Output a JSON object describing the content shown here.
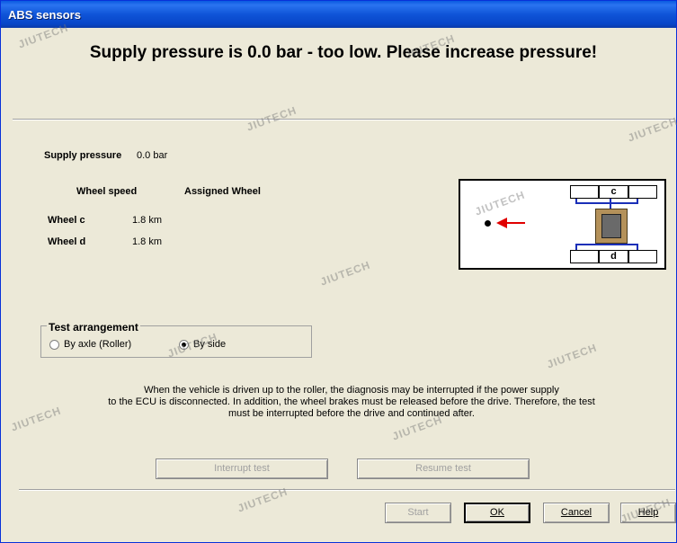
{
  "window": {
    "title": "ABS sensors"
  },
  "banner": {
    "message": "Supply pressure is  0.0 bar - too low. Please increase pressure!"
  },
  "supply": {
    "label": "Supply pressure",
    "value": "0.0 bar"
  },
  "table": {
    "headers": [
      "Wheel speed",
      "Assigned Wheel"
    ],
    "rows": [
      {
        "wheel": "Wheel c",
        "speed": "1.8 km"
      },
      {
        "wheel": "Wheel d",
        "speed": "1.8 km"
      }
    ]
  },
  "diagram": {
    "top_wheel": "c",
    "bottom_wheel": "d",
    "arrow_color": "#e00000",
    "axle_color": "#1a2fb8"
  },
  "test_arrangement": {
    "title": "Test arrangement",
    "options": [
      {
        "label": "By axle (Roller)",
        "selected": false
      },
      {
        "label": "By side",
        "selected": true
      }
    ]
  },
  "info": {
    "line1": "When the vehicle is driven up to the roller, the diagnosis may be interrupted if the power supply",
    "line2": "to the ECU is disconnected. In addition, the wheel brakes must be released before the drive. Therefore, the test",
    "line3": "must be interrupted before the drive and continued after."
  },
  "buttons": {
    "interrupt": {
      "label": "Interrupt test"
    },
    "resume": {
      "label": "Resume test"
    },
    "start": {
      "label": "Start"
    },
    "ok": {
      "label": "OK"
    },
    "cancel": {
      "label": "Cancel"
    },
    "help": {
      "label": "Help"
    }
  },
  "watermark": {
    "text": "JIUTECH"
  }
}
